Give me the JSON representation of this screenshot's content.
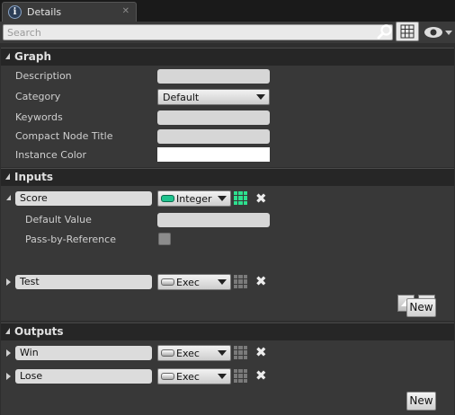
{
  "tab": {
    "title": "Details",
    "info_glyph": "i",
    "close_glyph": "✕"
  },
  "search": {
    "placeholder": "Search"
  },
  "graph": {
    "title": "Graph",
    "description_label": "Description",
    "category_label": "Category",
    "category_value": "Default",
    "keywords_label": "Keywords",
    "compact_node_title_label": "Compact Node Title",
    "instance_color_label": "Instance Color"
  },
  "inputs": {
    "title": "Inputs",
    "items": [
      {
        "name": "Score",
        "type": "Integer",
        "default_value_label": "Default Value",
        "pass_by_ref_label": "Pass-by-Reference"
      },
      {
        "name": "Test",
        "type": "Exec"
      }
    ],
    "new_label": "New"
  },
  "outputs": {
    "title": "Outputs",
    "items": [
      {
        "name": "Win",
        "type": "Exec"
      },
      {
        "name": "Lose",
        "type": "Exec"
      }
    ],
    "new_label": "New"
  },
  "icons": {
    "info": "info-icon",
    "close": "close-icon",
    "search": "search-icon",
    "grid": "grid-view-icon",
    "eye": "eye-icon",
    "remove": "remove-icon"
  },
  "colors": {
    "integer_pin": "#1fc38e",
    "background": "#383838",
    "section_header": "#262626"
  }
}
